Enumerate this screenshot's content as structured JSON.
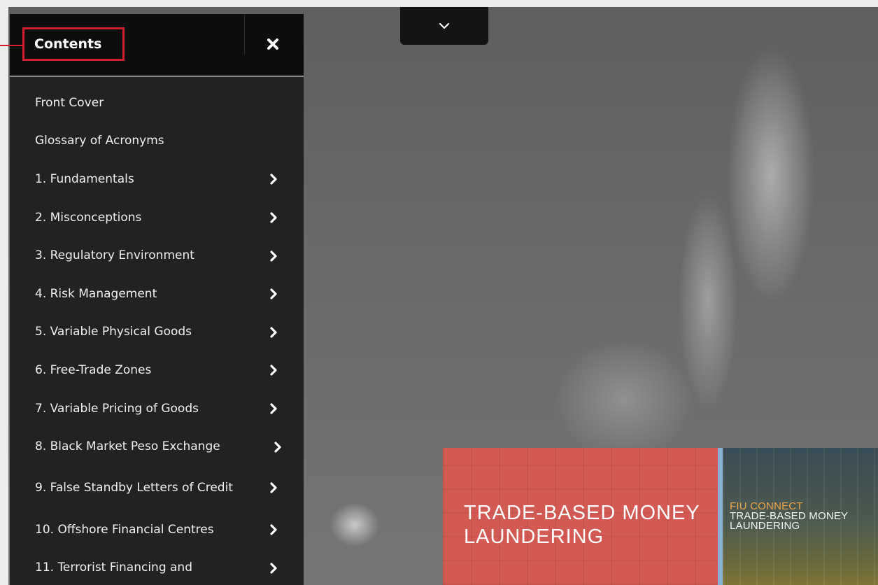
{
  "sidebar": {
    "title": "Contents",
    "close_icon": "close-icon",
    "items": [
      {
        "label": "Front Cover",
        "has_submenu": false
      },
      {
        "label": "Glossary of Acronyms",
        "has_submenu": false
      },
      {
        "label": "1. Fundamentals",
        "has_submenu": true
      },
      {
        "label": "2. Misconceptions",
        "has_submenu": true
      },
      {
        "label": "3. Regulatory Environment",
        "has_submenu": true
      },
      {
        "label": "4. Risk Management",
        "has_submenu": true
      },
      {
        "label": "5. Variable Physical Goods",
        "has_submenu": true
      },
      {
        "label": "6. Free-Trade Zones",
        "has_submenu": true
      },
      {
        "label": "7. Variable Pricing of Goods",
        "has_submenu": true
      },
      {
        "label": "8. Black Market Peso Exchange",
        "has_submenu": true
      },
      {
        "label": "9. False Standby Letters of Credit",
        "has_submenu": true
      },
      {
        "label": "10. Offshore Financial Centres",
        "has_submenu": true
      },
      {
        "label": "11. Terrorist Financing and",
        "has_submenu": true
      }
    ]
  },
  "top_toggle": {
    "icon": "chevron-down-icon"
  },
  "cover": {
    "red_panel_title": "TRADE-BASED MONEY LAUNDERING",
    "dark_panel": {
      "accent": "FIU CONNECT",
      "line1": "TRADE-BASED MONEY",
      "line2": "LAUNDERING"
    }
  },
  "colors": {
    "highlight": "#d21f2b",
    "sidebar_bg": "#222222",
    "header_bg": "#0d0d0d",
    "red_panel": "#d35a52",
    "divider_blue": "#88b1d8",
    "accent_orange": "#f0a64a"
  }
}
